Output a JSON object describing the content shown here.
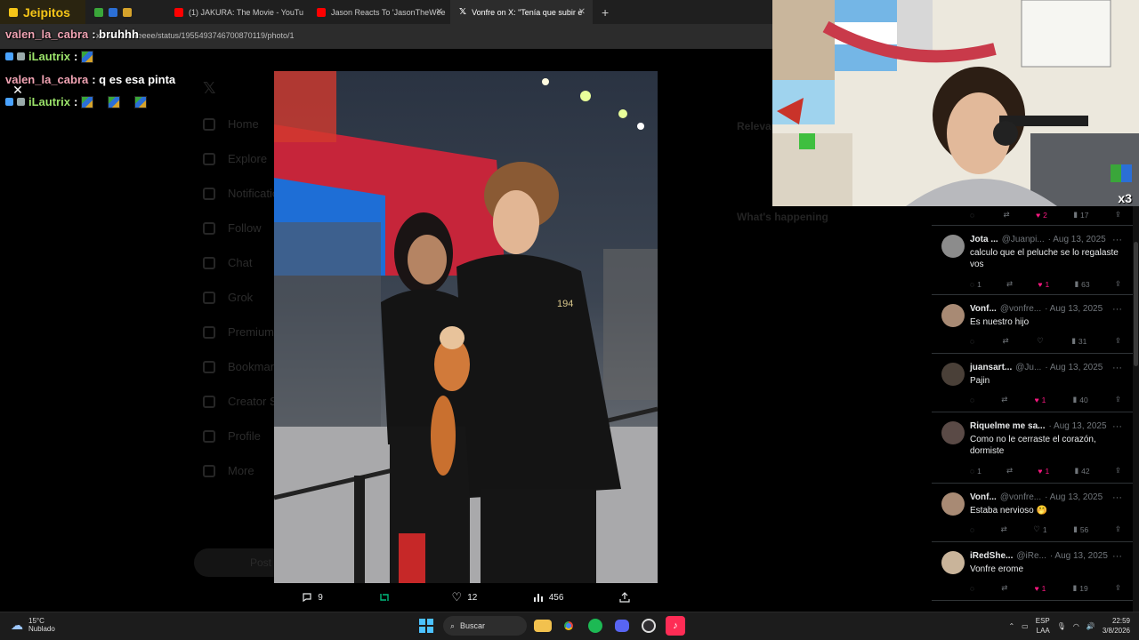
{
  "browser": {
    "tabs": [
      {
        "label": "Jeipitos",
        "favicon_color": "#f5c518"
      },
      {
        "label": "(1) JAKURA: The Movie - YouTu",
        "favicon_color": "#ff0000"
      },
      {
        "label": "Jason Reacts To 'JasonTheWee",
        "favicon_color": "#ff0000"
      },
      {
        "label": "Vonfre on X: \"Tenía que subir e",
        "favicon_color": "#ffffff"
      }
    ],
    "url": "x.com/vonfreeee/status/1955493746700870119/photo/1"
  },
  "chat": {
    "messages": [
      {
        "user": "valen_la_cabra",
        "text": ": bruhhh",
        "color": "pink"
      },
      {
        "user": "iLautrix",
        "text": ":",
        "color": "green",
        "emotes": 1
      },
      {
        "user": "valen_la_cabra",
        "text": ": q es esa pinta",
        "color": "pink"
      },
      {
        "user": "iLautrix",
        "text": ":",
        "color": "green",
        "emotes": 3
      }
    ]
  },
  "x_nav": {
    "items": [
      "Home",
      "Explore",
      "Notifications",
      "Follow",
      "Chat",
      "Grok",
      "Premium",
      "Bookmarks",
      "Creator Studio",
      "Profile",
      "More"
    ],
    "post_label": "Post"
  },
  "right_sidebar": {
    "relevant": "Relevant people",
    "happening": "What's happening"
  },
  "viewer": {
    "replies": "9",
    "reposts": "",
    "likes": "12",
    "views": "456"
  },
  "replies": [
    {
      "name": "",
      "handle": "",
      "date": "",
      "text": "",
      "reply_count": "",
      "like_count": "2",
      "views": "17",
      "liked": true
    },
    {
      "name": "Jota ...",
      "handle": "@Juanpi...",
      "date": "· Aug 13, 2025",
      "text": "calculo que el peluche se lo regalaste vos",
      "reply_count": "1",
      "like_count": "1",
      "views": "63",
      "liked": true
    },
    {
      "name": "Vonf...",
      "handle": "@vonfre...",
      "date": "· Aug 13, 2025",
      "text": "Es nuestro hijo",
      "reply_count": "",
      "like_count": "",
      "views": "31",
      "liked": false
    },
    {
      "name": "juansart...",
      "handle": "@Ju...",
      "date": "· Aug 13, 2025",
      "text": "Pajin",
      "reply_count": "",
      "like_count": "1",
      "views": "40",
      "liked": true
    },
    {
      "name": "Riquelme me sa...",
      "handle": "",
      "date": "· Aug 13, 2025",
      "text": "Como no le cerraste el corazón, dormiste",
      "reply_count": "1",
      "like_count": "1",
      "views": "42",
      "liked": true
    },
    {
      "name": "Vonf...",
      "handle": "@vonfre...",
      "date": "· Aug 13, 2025",
      "text": "Estaba nervioso 🤭",
      "reply_count": "",
      "like_count": "1",
      "views": "56",
      "liked": false
    },
    {
      "name": "iRedShe...",
      "handle": "@iRe...",
      "date": "· Aug 13, 2025",
      "text": "Vonfre erome",
      "reply_count": "",
      "like_count": "1",
      "views": "19",
      "liked": true
    }
  ],
  "taskbar": {
    "temp": "15°C",
    "condition": "Nublado",
    "search_placeholder": "Buscar",
    "lang": "ESP",
    "lang2": "LAA",
    "time": "22:59",
    "date": "3/8/2026"
  },
  "cam": {
    "overlay_text": "x3"
  }
}
